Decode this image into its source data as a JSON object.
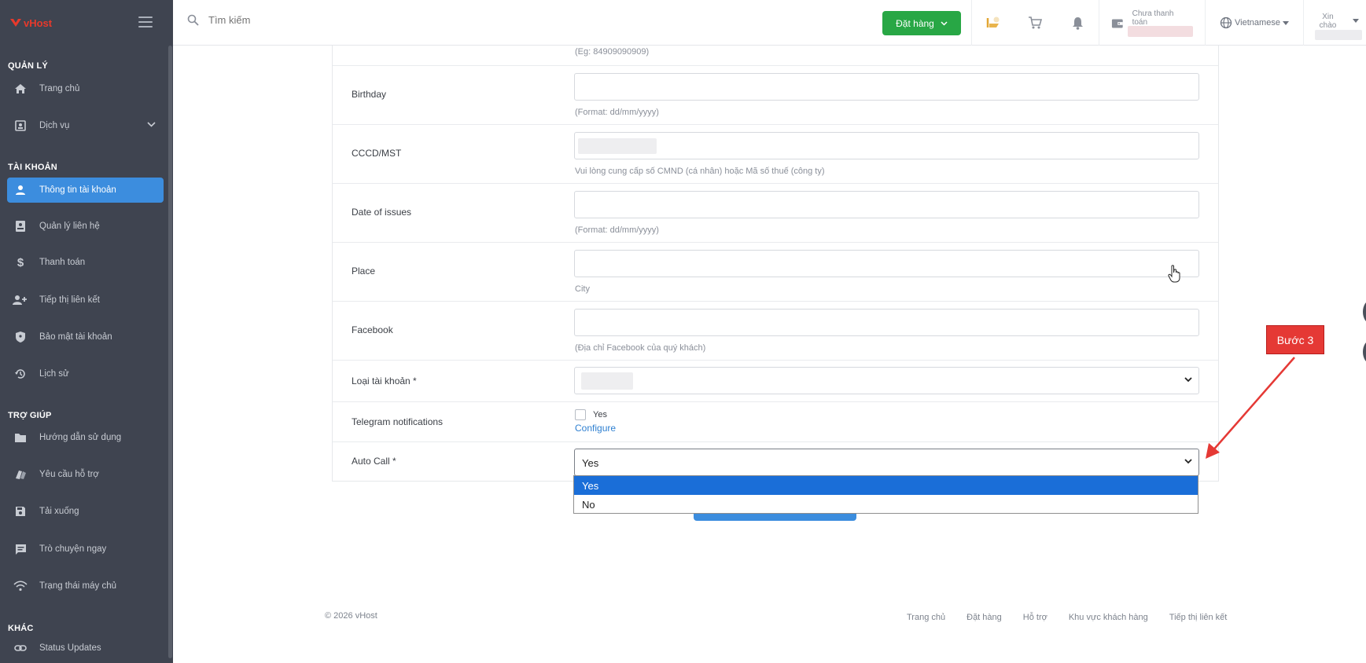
{
  "brand": {
    "logo_text": "vHost",
    "accent": "#e8392b"
  },
  "sidebar": {
    "sections": [
      {
        "title": "QUẢN LÝ"
      },
      {
        "title": "TÀI KHOẢN"
      },
      {
        "title": "TRỢ GIÚP"
      },
      {
        "title": "KHÁC"
      }
    ],
    "items": [
      {
        "label": "Trang chủ",
        "icon": "home-icon"
      },
      {
        "label": "Dịch vụ",
        "icon": "id-card-icon"
      },
      {
        "label": "Thông tin tài khoản",
        "icon": "user-icon",
        "active": true
      },
      {
        "label": "Quản lý liên hệ",
        "icon": "contacts-icon"
      },
      {
        "label": "Thanh toán",
        "icon": "dollar-icon"
      },
      {
        "label": "Tiếp thị liên kết",
        "icon": "user-plus-icon"
      },
      {
        "label": "Bảo mật tài khoản",
        "icon": "shield-icon"
      },
      {
        "label": "Lịch sử",
        "icon": "history-icon"
      },
      {
        "label": "Hướng dẫn sử dụng",
        "icon": "folder-icon"
      },
      {
        "label": "Yêu cầu hỗ trợ",
        "icon": "tickets-icon"
      },
      {
        "label": "Tải xuống",
        "icon": "save-icon"
      },
      {
        "label": "Trò chuyện ngay",
        "icon": "chat-icon"
      },
      {
        "label": "Trạng thái máy chủ",
        "icon": "wifi-icon"
      },
      {
        "label": "Status Updates",
        "icon": "link-icon"
      }
    ]
  },
  "header": {
    "search_placeholder": "Tìm kiếm",
    "order_label": "Đặt hàng",
    "balance_label": "Chưa thanh toán",
    "language": "Vietnamese",
    "greeting": "Xin chào"
  },
  "form": {
    "phone_hint": "(Eg: 84909090909)",
    "rows": [
      {
        "label": "Birthday",
        "hint": "(Format: dd/mm/yyyy)"
      },
      {
        "label": "CCCD/MST",
        "hint": "Vui lòng cung cấp số CMND (cá nhân) hoặc Mã số thuế (công ty)"
      },
      {
        "label": "Date of issues",
        "hint": "(Format: dd/mm/yyyy)"
      },
      {
        "label": "Place",
        "hint": "City"
      },
      {
        "label": "Facebook",
        "hint": "(Địa chỉ Facebook của quý khách)"
      },
      {
        "label": "Loại tài khoản *"
      },
      {
        "label": "Telegram notifications",
        "checkbox_label": "Yes",
        "link": "Configure"
      },
      {
        "label": "Auto Call *",
        "value": "Yes"
      }
    ],
    "auto_call_options": [
      "Yes",
      "No"
    ],
    "auto_call_selected": "Yes"
  },
  "footer": {
    "copyright": "© 2026 vHost",
    "links": [
      "Trang chủ",
      "Đặt hàng",
      "Hỗ trợ",
      "Khu vực khách hàng",
      "Tiếp thị liên kết"
    ]
  },
  "annotation": {
    "label": "Bước 3",
    "color": "#e53935"
  }
}
